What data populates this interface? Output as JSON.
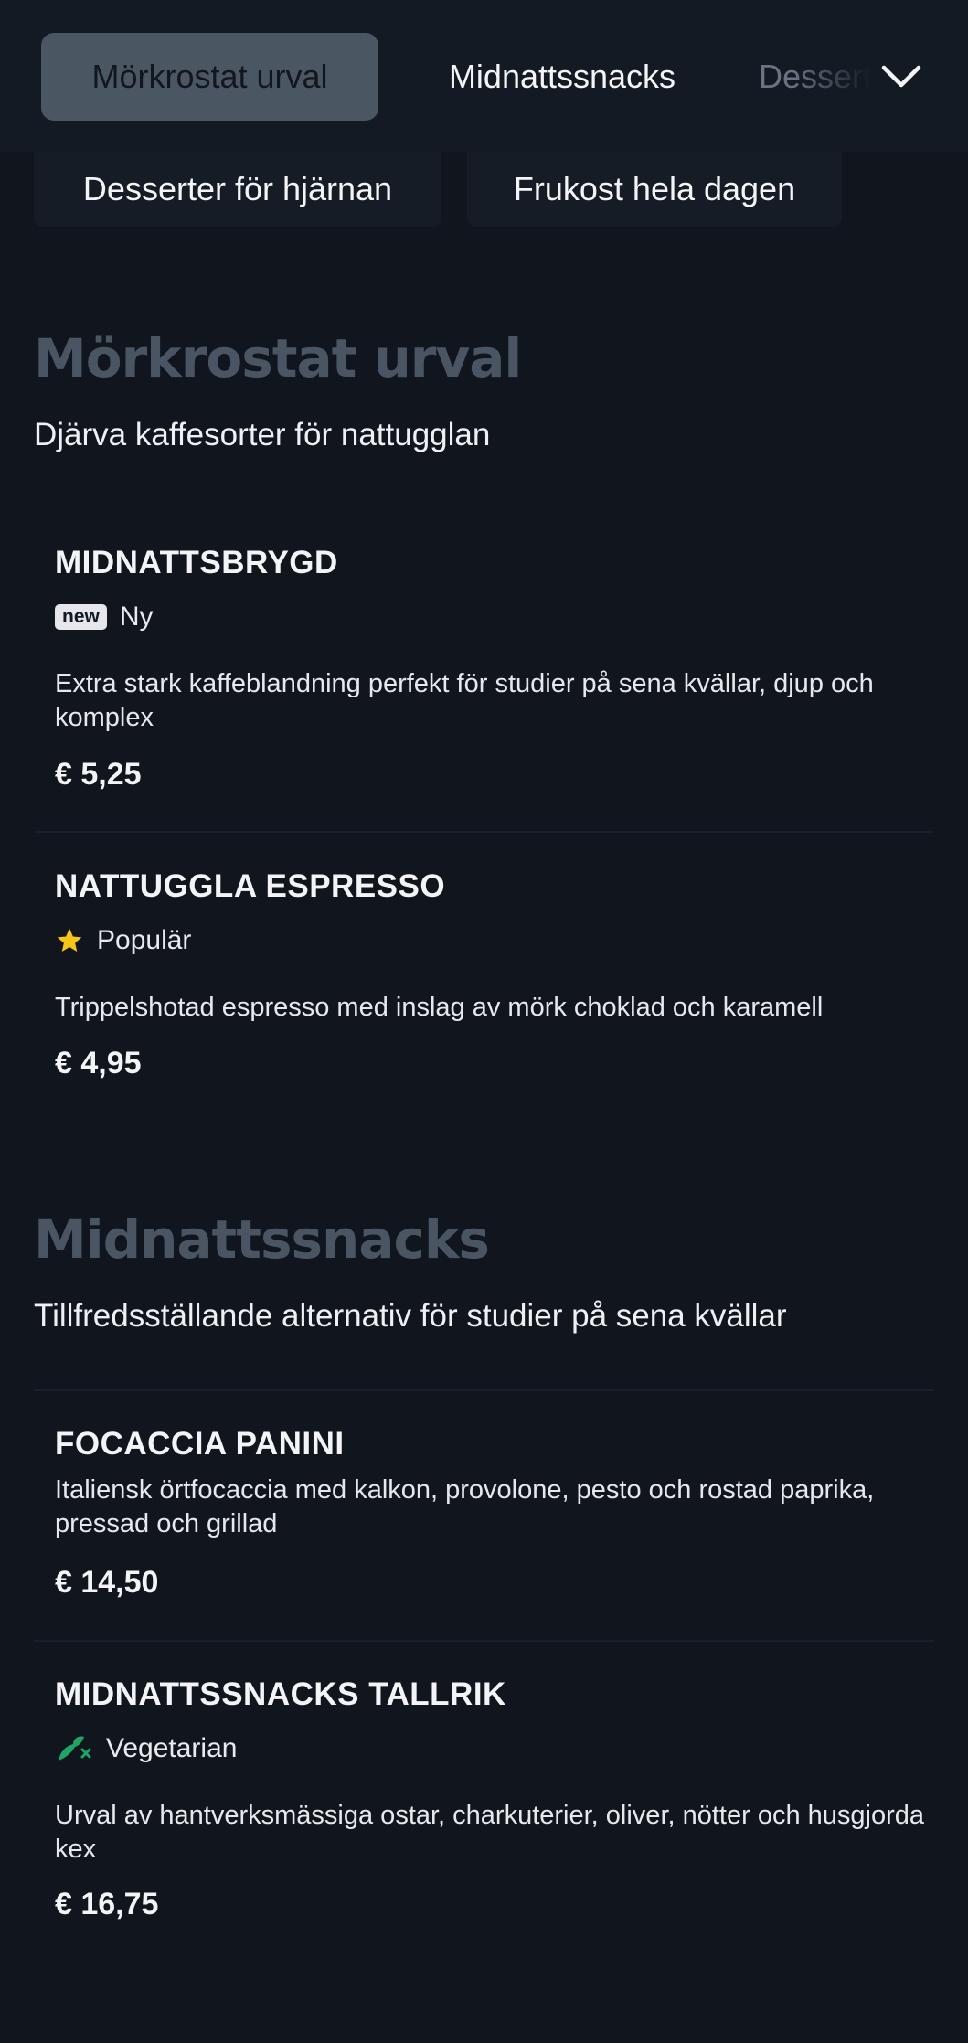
{
  "tabs": [
    {
      "label": "Mörkrostat urval",
      "active": true
    },
    {
      "label": "Midnattssnacks",
      "active": false
    },
    {
      "label": "Desserter för hjärnan",
      "active": false
    }
  ],
  "tabs_overflow": [
    {
      "label": "Desserter för hjärnan"
    },
    {
      "label": "Frukost hela dagen"
    }
  ],
  "sections": [
    {
      "title": "Mörkrostat urval",
      "subtitle": "Djärva kaffesorter för nattugglan",
      "items": [
        {
          "name": "MIDNATTSBRYGD",
          "badge": "new",
          "tag": "Ny",
          "description": "Extra stark kaffeblandning perfekt för studier på sena kvällar, djup och komplex",
          "price": "€ 5,25"
        },
        {
          "name": "NATTUGGLA ESPRESSO",
          "tag_icon": "star-icon",
          "tag": "Populär",
          "description": "Trippelshotad espresso med inslag av mörk choklad och karamell",
          "price": "€ 4,95"
        }
      ]
    },
    {
      "title": "Midnattssnacks",
      "subtitle": "Tillfredsställande alternativ för studier på sena kvällar",
      "items": [
        {
          "name": "FOCACCIA PANINI",
          "description": "Italiensk örtfocaccia med kalkon, provolone, pesto och rostad paprika, pressad och grillad",
          "price": "€ 14,50"
        },
        {
          "name": "MIDNATTSSNACKS TALLRIK",
          "tag_icon": "vegetarian-leaf-icon",
          "tag": "Vegetarian",
          "description": "Urval av hantverksmässiga ostar, charkuterier, oliver, nötter och husgjorda kex",
          "price": "€ 16,75"
        }
      ]
    }
  ],
  "colors": {
    "background": "#11161e",
    "active_tab": "#4b5663",
    "section_title": "#4a5563",
    "star": "#f5c518",
    "leaf": "#1fa463"
  }
}
